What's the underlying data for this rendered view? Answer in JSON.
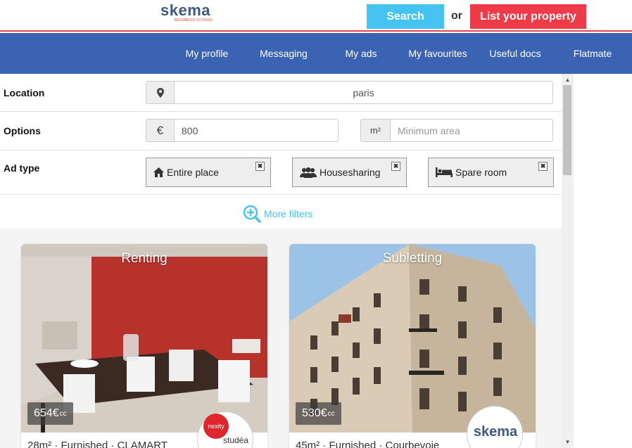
{
  "header": {
    "logo_text": "skema",
    "logo_subtext": "BUSINESS SCHOOL",
    "search_label": "Search",
    "or_label": "or",
    "list_property_label": "List your property"
  },
  "nav": {
    "items": [
      {
        "label": "My profile"
      },
      {
        "label": "Messaging"
      },
      {
        "label": "My ads"
      },
      {
        "label": "My favourites"
      },
      {
        "label": "Useful docs"
      },
      {
        "label": "Flatmate"
      }
    ]
  },
  "filters": {
    "location_label": "Location",
    "location_value": "paris",
    "options_label": "Options",
    "currency_symbol": "€",
    "budget_value": "800",
    "area_unit": "m²",
    "area_placeholder": "Minimum area",
    "adtype_label": "Ad type",
    "adtypes": [
      {
        "label": "Entire place",
        "icon": "home-icon"
      },
      {
        "label": "Housesharing",
        "icon": "users-icon"
      },
      {
        "label": "Spare room",
        "icon": "bed-icon"
      }
    ],
    "more_filters_label": "More filters"
  },
  "listings": [
    {
      "type": "Renting",
      "price": "654€",
      "price_suffix": "cc",
      "description": "28m² · Furnished · CLAMART",
      "badge": "nexity studéa"
    },
    {
      "type": "Subletting",
      "price": "530€",
      "price_suffix": "cc",
      "description": "45m² · Furnished · Courbevoie",
      "badge": "skema"
    }
  ],
  "colors": {
    "nav_bg": "#3a63b4",
    "search_btn": "#45c3f1",
    "list_btn": "#ef3a48",
    "accent_line": "#e8444a"
  }
}
